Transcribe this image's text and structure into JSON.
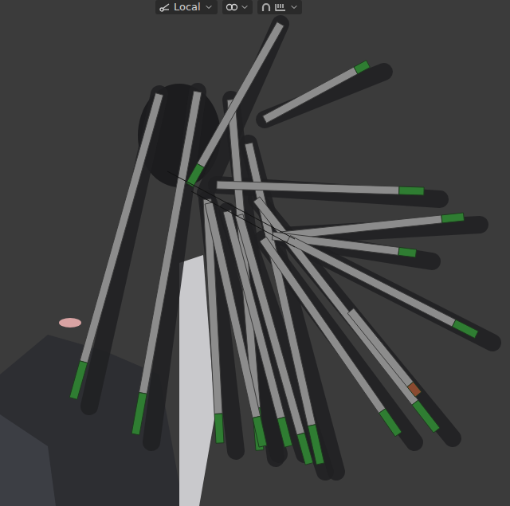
{
  "header": {
    "transform_orientation": {
      "label": "Local"
    },
    "snapping": {
      "enabled": false
    }
  }
}
